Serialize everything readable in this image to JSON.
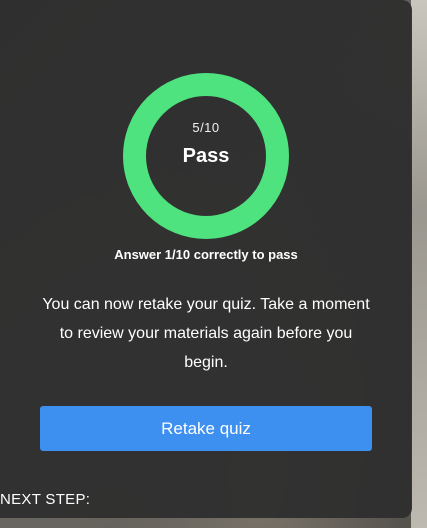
{
  "result": {
    "score_text": "5/10",
    "status_text": "Pass",
    "ring_color": "#4ee37f",
    "progress_fraction": 1.0
  },
  "requirement_text": "Answer 1/10 correctly to pass",
  "message_text": "You can now retake your quiz. Take a moment to review your materials again before you begin.",
  "retake_button": {
    "label": "Retake quiz",
    "color": "#3d8ff0"
  },
  "next_step_label": "NEXT STEP:"
}
